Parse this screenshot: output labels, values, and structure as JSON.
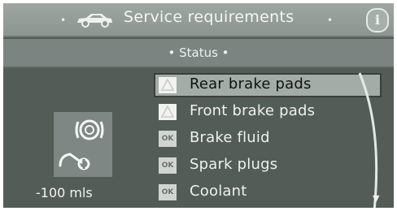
{
  "header": {
    "title": "Service requirements",
    "icons": {
      "vehicle": "car-icon",
      "info": "info-icon"
    },
    "info_label": "i"
  },
  "status": {
    "label": "Status"
  },
  "left_panel": {
    "icons": [
      "brake-service-icon",
      "wrench-service-icon"
    ],
    "distance": "-100 mls"
  },
  "items": [
    {
      "label": "Rear brake pads",
      "badge": "warning",
      "selected": true
    },
    {
      "label": "Front brake pads",
      "badge": "warning",
      "selected": false
    },
    {
      "label": "Brake fluid",
      "badge": "OK",
      "selected": false
    },
    {
      "label": "Spark plugs",
      "badge": "OK",
      "selected": false
    },
    {
      "label": "Coolant",
      "badge": "OK",
      "selected": false
    }
  ],
  "colors": {
    "background": "#545c58",
    "title_bar": "#8d9591",
    "status_bar": "#7b8480",
    "selection": "#a4aca8",
    "text": "#f2f2f0"
  }
}
